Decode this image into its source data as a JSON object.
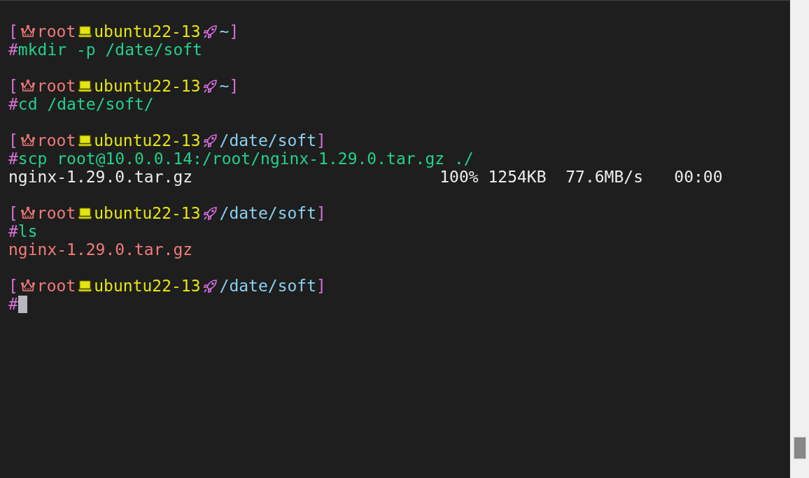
{
  "terminal": {
    "blocks": [
      {
        "prompt": {
          "open": "[",
          "user": "root",
          "host": "ubuntu22-13",
          "cwd": "~",
          "close": "]",
          "sign": "#"
        },
        "command": "mkdir -p /date/soft"
      },
      {
        "prompt": {
          "open": "[",
          "user": "root",
          "host": "ubuntu22-13",
          "cwd": "~",
          "close": "]",
          "sign": "#"
        },
        "command": "cd /date/soft/"
      },
      {
        "prompt": {
          "open": "[",
          "user": "root",
          "host": "ubuntu22-13",
          "cwd": "/date/soft",
          "close": "]",
          "sign": "#"
        },
        "command": "scp root@10.0.0.14:/root/nginx-1.29.0.tar.gz ./",
        "output": [
          {
            "kind": "transfer",
            "file": "nginx-1.29.0.tar.gz",
            "percent": "100%",
            "size": "1254KB",
            "rate": "77.6MB/s",
            "time": "00:00"
          }
        ]
      },
      {
        "prompt": {
          "open": "[",
          "user": "root",
          "host": "ubuntu22-13",
          "cwd": "/date/soft",
          "close": "]",
          "sign": "#"
        },
        "command": "ls",
        "output": [
          {
            "kind": "archive",
            "file": "nginx-1.29.0.tar.gz"
          }
        ]
      },
      {
        "prompt": {
          "open": "[",
          "user": "root",
          "host": "ubuntu22-13",
          "cwd": "/date/soft",
          "close": "]",
          "sign": "#"
        },
        "cursor": true
      }
    ]
  }
}
